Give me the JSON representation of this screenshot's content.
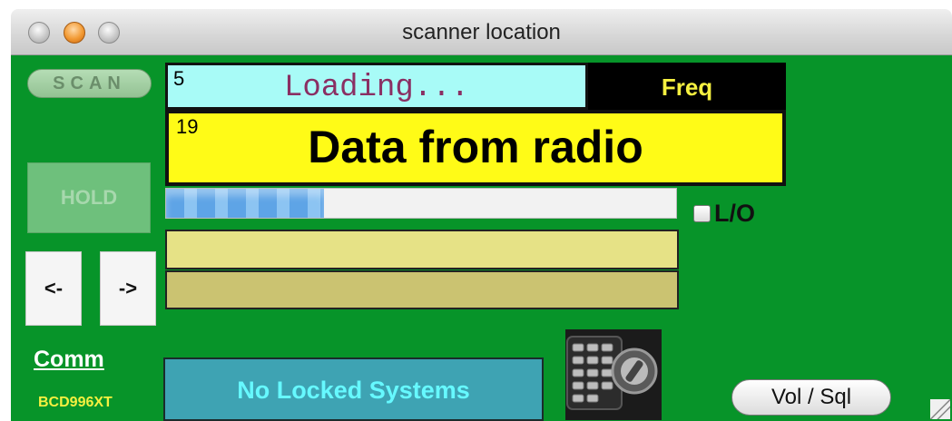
{
  "window": {
    "title": "scanner location"
  },
  "controls": {
    "scan_label": "SCAN",
    "hold_label": "HOLD",
    "prev_label": "<-",
    "next_label": "->",
    "vol_sql_label": "Vol / Sql",
    "lo_label": "L/O"
  },
  "display": {
    "channel_number": "5",
    "alpha_tag": "Loading...",
    "freq_label": "Freq",
    "data_number": "19",
    "data_text": "Data from radio",
    "progress": 0.31,
    "locked_systems": "No Locked Systems"
  },
  "comm": {
    "label": "Comm",
    "model": "BCD996XT"
  },
  "icons": {
    "radio": "scanner-radio-image",
    "resize": "resize-grip-icon"
  },
  "colors": {
    "panel_green": "#079429",
    "name_bg": "#a8fbf7",
    "loading_text": "#8a2f63",
    "data_bg": "#fffb17",
    "freq_text": "#f5f040",
    "locked_bg": "#3ea3b3",
    "locked_text": "#66f9ff"
  }
}
